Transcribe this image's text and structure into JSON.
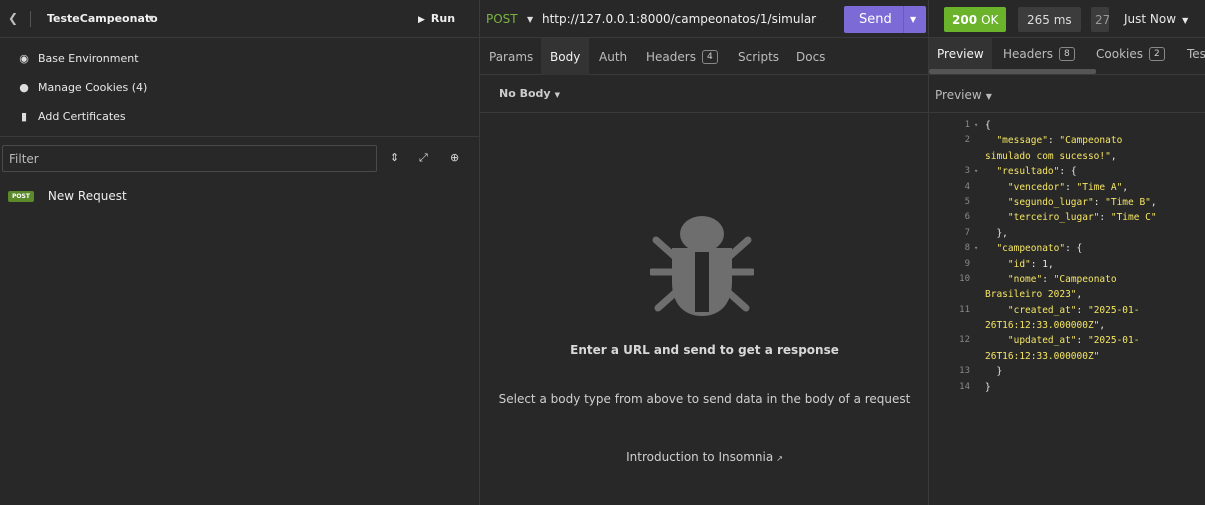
{
  "sidebar": {
    "back_icon": "chevron-left-icon",
    "project_title": "TesteCampeonato",
    "run_label": "Run",
    "links": [
      {
        "label": "Base Environment",
        "icon": "globe-icon"
      },
      {
        "label": "Manage Cookies (4)",
        "icon": "cookie-icon"
      },
      {
        "label": "Add Certificates",
        "icon": "file-icon"
      }
    ],
    "filter_placeholder": "Filter",
    "requests": [
      {
        "method": "POST",
        "name": "New Request"
      }
    ]
  },
  "request": {
    "method": "POST",
    "url": "http://127.0.0.1:8000/campeonatos/1/simular",
    "send_label": "Send",
    "tabs": [
      {
        "label": "Params"
      },
      {
        "label": "Body",
        "active": true
      },
      {
        "label": "Auth"
      },
      {
        "label": "Headers",
        "count": "4"
      },
      {
        "label": "Scripts"
      },
      {
        "label": "Docs"
      }
    ],
    "body_type": "No Body",
    "empty_title": "Enter a URL and send to get a response",
    "empty_subtitle": "Select a body type from above to send data in the body of a request",
    "intro_link": "Introduction to Insomnia"
  },
  "response": {
    "status_code": "200",
    "status_text": "OK",
    "time": "265 ms",
    "size_partial": "27",
    "timestamp": "Just Now",
    "tabs": [
      {
        "label": "Preview",
        "active": true
      },
      {
        "label": "Headers",
        "count": "8"
      },
      {
        "label": "Cookies",
        "count": "2"
      },
      {
        "label": "Tes"
      }
    ],
    "preview_label": "Preview",
    "lines": [
      {
        "n": "1",
        "fold": true,
        "html": "<span class='p'>{</span>"
      },
      {
        "n": "2",
        "html": "  <span class='k'>\"message\"</span><span class='p'>: </span><span class='s'>\"Campeonato</span>"
      },
      {
        "n": "",
        "html": "<span class='s'>simulado com sucesso!\"</span><span class='p'>,</span>"
      },
      {
        "n": "3",
        "fold": true,
        "html": "  <span class='k'>\"resultado\"</span><span class='p'>: {</span>"
      },
      {
        "n": "4",
        "html": "    <span class='k'>\"vencedor\"</span><span class='p'>: </span><span class='s'>\"Time A\"</span><span class='p'>,</span>"
      },
      {
        "n": "5",
        "html": "    <span class='k'>\"segundo_lugar\"</span><span class='p'>: </span><span class='s'>\"Time B\"</span><span class='p'>,</span>"
      },
      {
        "n": "6",
        "html": "    <span class='k'>\"terceiro_lugar\"</span><span class='p'>: </span><span class='s'>\"Time C\"</span>"
      },
      {
        "n": "7",
        "html": "  <span class='p'>},</span>"
      },
      {
        "n": "8",
        "fold": true,
        "html": "  <span class='k'>\"campeonato\"</span><span class='p'>: {</span>"
      },
      {
        "n": "9",
        "html": "    <span class='k'>\"id\"</span><span class='p'>: 1,</span>"
      },
      {
        "n": "10",
        "html": "    <span class='k'>\"nome\"</span><span class='p'>: </span><span class='s'>\"Campeonato</span>"
      },
      {
        "n": "",
        "html": "<span class='s'>Brasileiro 2023\"</span><span class='p'>,</span>"
      },
      {
        "n": "11",
        "html": "    <span class='k'>\"created_at\"</span><span class='p'>: </span><span class='s'>\"2025-01-</span>"
      },
      {
        "n": "",
        "html": "<span class='s'>26T16:12:33.000000Z\"</span><span class='p'>,</span>"
      },
      {
        "n": "12",
        "html": "    <span class='k'>\"updated_at\"</span><span class='p'>: </span><span class='s'>\"2025-01-</span>"
      },
      {
        "n": "",
        "html": "<span class='s'>26T16:12:33.000000Z\"</span>"
      },
      {
        "n": "13",
        "html": "  <span class='p'>}</span>"
      },
      {
        "n": "14",
        "html": "<span class='p'>}</span>"
      }
    ]
  },
  "colors": {
    "accent_send": "#7c6bd6",
    "status_ok": "#6ab32a",
    "method_post": "#7cb342",
    "json_string": "#f5e663"
  }
}
